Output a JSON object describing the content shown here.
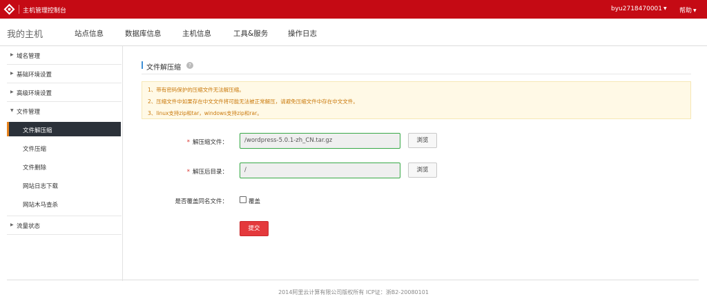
{
  "topbar": {
    "app_title": "主机管理控制台",
    "user": "byu2718470001",
    "help": "帮助",
    "bg_color": "#c50a14"
  },
  "navbar": {
    "brand": "我的主机",
    "items": [
      "站点信息",
      "数据库信息",
      "主机信息",
      "工具&服务",
      "操作日志"
    ]
  },
  "sidebar": {
    "groups": [
      {
        "label": "域名管理",
        "expanded": false
      },
      {
        "label": "基础环境设置",
        "expanded": false
      },
      {
        "label": "高级环境设置",
        "expanded": false
      },
      {
        "label": "文件管理",
        "expanded": true
      },
      {
        "label": "流量状态",
        "expanded": false
      }
    ],
    "sub_items": [
      "文件解压缩",
      "文件压缩",
      "文件删除",
      "网站日志下载",
      "网站木马查杀"
    ],
    "active": "文件解压缩"
  },
  "main": {
    "title": "文件解压缩",
    "help_icon": "question-icon",
    "notices": [
      "1、带有密码保护的压缩文件无法解压缩。",
      "2、压缩文件中如果存在中文文件将可能无法被正常解压，请避免压缩文件中存在中文文件。",
      "3、linux支持zip和tar，windows支持zip和rar。"
    ],
    "form": {
      "archive_label": "解压缩文件：",
      "archive_value": "/wordpress-5.0.1-zh_CN.tar.gz",
      "target_label": "解压后目录：",
      "target_value": "/",
      "browse": "浏览",
      "overwrite_label": "是否覆盖同名文件：",
      "overwrite_option": "覆盖",
      "overwrite_checked": false,
      "required_mark": "*",
      "submit": "提交"
    }
  },
  "footer": {
    "copyright": "2014阿里云计算有限公司版权所有 ICP证：浙B2-20080101"
  }
}
